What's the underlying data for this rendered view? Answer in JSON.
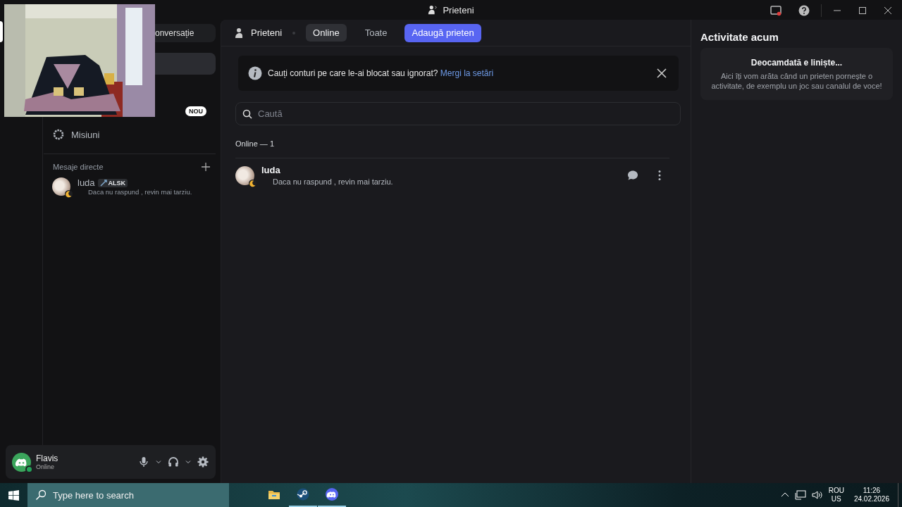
{
  "window": {
    "title": "Prieteni"
  },
  "sidebar": {
    "conversation_button": "onversație",
    "new_badge": "NOU",
    "items": [
      {
        "label": "Misiuni"
      }
    ],
    "dm_header": "Mesaje directe",
    "dms": [
      {
        "name": "luda",
        "tag": "ALSK",
        "status_text": "Daca nu raspund , revin mai tarziu.",
        "color": "#f0b232"
      }
    ]
  },
  "user_panel": {
    "name": "Flavis",
    "status": "Online",
    "color": "#23a55a"
  },
  "header": {
    "title": "Prieteni",
    "tabs": [
      {
        "label": "Online",
        "selected": true
      },
      {
        "label": "Toate",
        "selected": false
      }
    ],
    "add_button": "Adaugă prieten"
  },
  "notice": {
    "text": "Cauți conturi pe care le-ai blocat sau ignorat?",
    "link": "Mergi la setări"
  },
  "search": {
    "placeholder": "Caută"
  },
  "list_header": "Online — 1",
  "friends": [
    {
      "name": "luda",
      "status_text": "Daca nu raspund , revin mai tarziu.",
      "color": "#f0b232"
    }
  ],
  "activity": {
    "title": "Activitate acum",
    "empty_title": "Deocamdată e liniște...",
    "empty_text": "Aici îți vom arăta când un prieten pornește o activitate, de exemplu un joc sau canalul de voce!"
  },
  "taskbar": {
    "search_placeholder": "Type here to search",
    "apps": [
      {
        "kind": "folder",
        "running": false
      },
      {
        "kind": "steam",
        "running": true
      },
      {
        "kind": "discord",
        "running": true
      }
    ],
    "language": "ROU",
    "layout": "US",
    "time": "11:26",
    "date": "24.02.2026"
  }
}
